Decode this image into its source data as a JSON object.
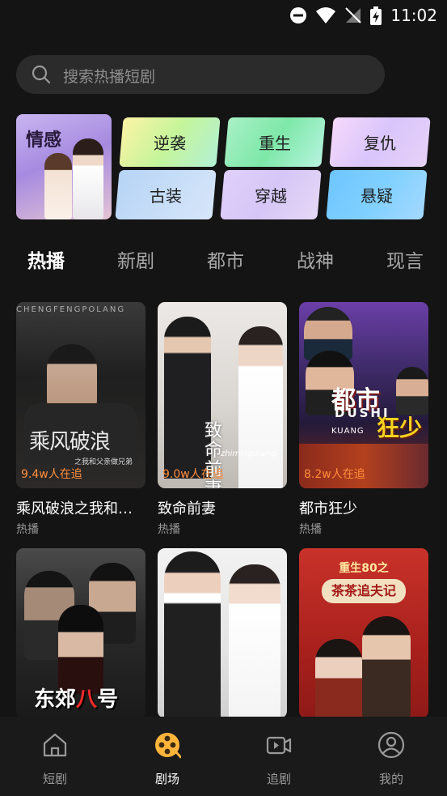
{
  "status": {
    "time": "11:02"
  },
  "search": {
    "placeholder": "搜索热播短剧"
  },
  "feature": {
    "label": "情感"
  },
  "genres": [
    "逆袭",
    "重生",
    "复仇",
    "古装",
    "穿越",
    "悬疑"
  ],
  "tabs": [
    "热播",
    "新剧",
    "都市",
    "战神",
    "现言"
  ],
  "dramas": [
    {
      "title": "乘风破浪之我和…",
      "tag": "热播",
      "watching": "9.4w人在追",
      "poster_text": "乘风破浪",
      "poster_top": "CHENGFENGPOLANG",
      "poster_sub": "之我和父亲做兄弟"
    },
    {
      "title": "致命前妻",
      "tag": "热播",
      "watching": "9.0w人在追",
      "poster_text": "致命前妻",
      "poster_sub": "zhimingqianqi"
    },
    {
      "title": "都市狂少",
      "tag": "热播",
      "watching": "8.2w人在追",
      "poster_text": "都市",
      "poster_sub": "DUSHI",
      "poster_text2": "狂少",
      "poster_sub2": "KUANG"
    }
  ],
  "dramas_row2": [
    {
      "poster_text": "东郊",
      "poster_accent": "八",
      "poster_suffix": "号"
    },
    {
      "poster_text": ""
    },
    {
      "poster_top": "重生80之",
      "poster_text": "茶茶追夫记"
    }
  ],
  "nav": [
    {
      "label": "短剧",
      "icon": "home-icon"
    },
    {
      "label": "剧场",
      "icon": "theater-reel-icon"
    },
    {
      "label": "追剧",
      "icon": "video-camera-icon"
    },
    {
      "label": "我的",
      "icon": "profile-icon"
    }
  ],
  "colors": {
    "watching": "#ff8d3a",
    "accent": "#ffb43a",
    "background": "#141414"
  }
}
